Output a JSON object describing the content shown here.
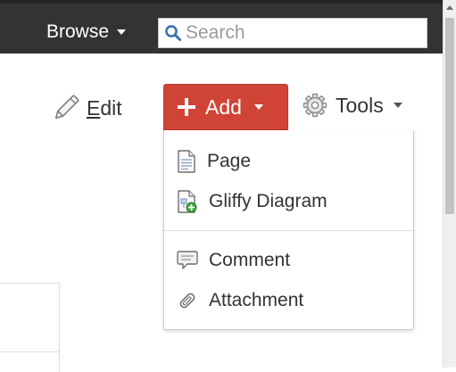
{
  "header": {
    "browse_label": "Browse",
    "search": {
      "placeholder": "Search",
      "value": ""
    }
  },
  "toolbar": {
    "edit_label": "Edit",
    "add_label": "Add",
    "tools_label": "Tools"
  },
  "add_menu": {
    "sections": [
      {
        "items": [
          {
            "label": "Page",
            "icon": "page-icon"
          },
          {
            "label": "Gliffy Diagram",
            "icon": "gliffy-diagram-icon"
          }
        ]
      },
      {
        "items": [
          {
            "label": "Comment",
            "icon": "comment-icon"
          },
          {
            "label": "Attachment",
            "icon": "attachment-icon"
          }
        ]
      }
    ]
  },
  "colors": {
    "header_bg": "#333333",
    "add_button_bg": "#d04437",
    "search_icon": "#3b73af"
  }
}
